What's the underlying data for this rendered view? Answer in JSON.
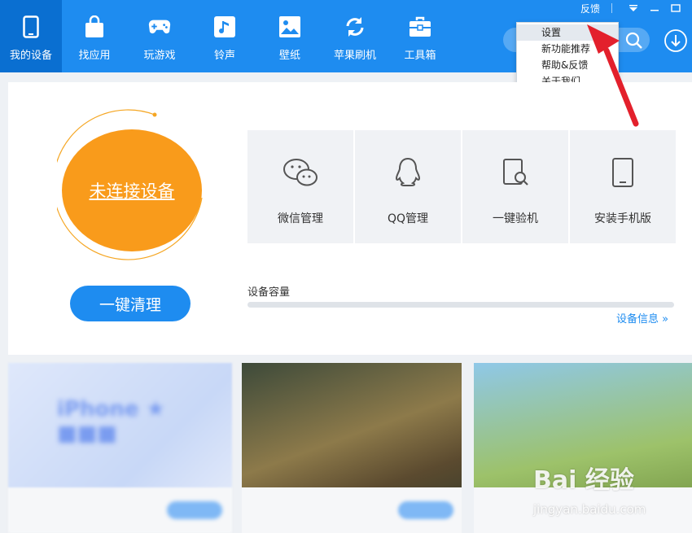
{
  "colors": {
    "brand": "#1e8cf0",
    "brand_dark": "#0a6fd1",
    "orange": "#f99b1b",
    "arrow": "#e3202c"
  },
  "nav": {
    "items": [
      {
        "label": "我的设备",
        "icon": "phone-icon"
      },
      {
        "label": "找应用",
        "icon": "shopping-bag-icon"
      },
      {
        "label": "玩游戏",
        "icon": "gamepad-icon"
      },
      {
        "label": "铃声",
        "icon": "music-note-icon"
      },
      {
        "label": "壁纸",
        "icon": "image-icon"
      },
      {
        "label": "苹果刷机",
        "icon": "refresh-icon"
      },
      {
        "label": "工具箱",
        "icon": "toolbox-icon"
      }
    ]
  },
  "window": {
    "feedback": "反馈"
  },
  "menu": {
    "items": [
      "设置",
      "新功能推荐",
      "帮助&反馈",
      "关于我们"
    ]
  },
  "device": {
    "status": "未连接设备",
    "clean_button": "一键清理"
  },
  "tools": [
    {
      "label": "微信管理",
      "icon": "wechat-icon"
    },
    {
      "label": "QQ管理",
      "icon": "qq-penguin-icon"
    },
    {
      "label": "一键验机",
      "icon": "tablet-search-icon"
    },
    {
      "label": "安装手机版",
      "icon": "tablet-icon"
    }
  ],
  "capacity": {
    "label": "设备容量",
    "info_link": "设备信息 »"
  },
  "watermark": {
    "main": "Bai 经验",
    "sub": "jingyan.baidu.com"
  }
}
